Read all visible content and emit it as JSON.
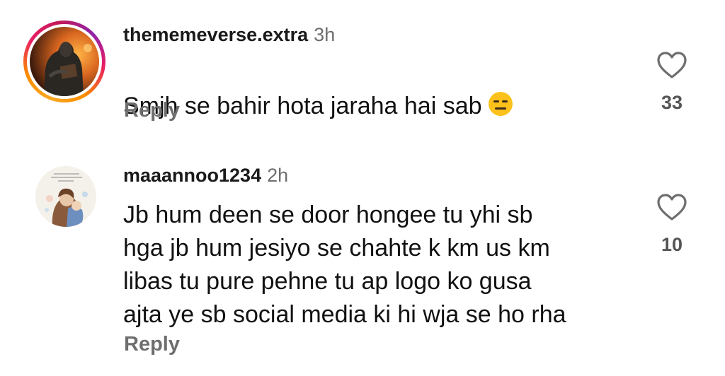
{
  "comments": [
    {
      "username": "thememeverse.extra",
      "time": "3h",
      "text": "Smjh se bahir hota jaraha hai sab",
      "emoji": "expressionless-face",
      "reply_label": "Reply",
      "likes": "33",
      "avatar_has_story_ring": true
    },
    {
      "username": "maaannoo1234",
      "time": "2h",
      "text": "Jb hum deen se door hongee tu yhi sb\nhga jb hum jesiyo se chahte k km us km\nlibas tu pure pehne tu ap logo ko gusa\najta ye sb social media ki hi wja se ho rha",
      "reply_label": "Reply",
      "likes": "10",
      "avatar_has_story_ring": false
    }
  ],
  "colors": {
    "background": "#ffffff",
    "text": "#111111",
    "muted": "#6e6e6e",
    "ring_start": "#f9a825",
    "ring_end": "#8e24aa"
  },
  "icons": {
    "like": "heart-outline-icon"
  }
}
